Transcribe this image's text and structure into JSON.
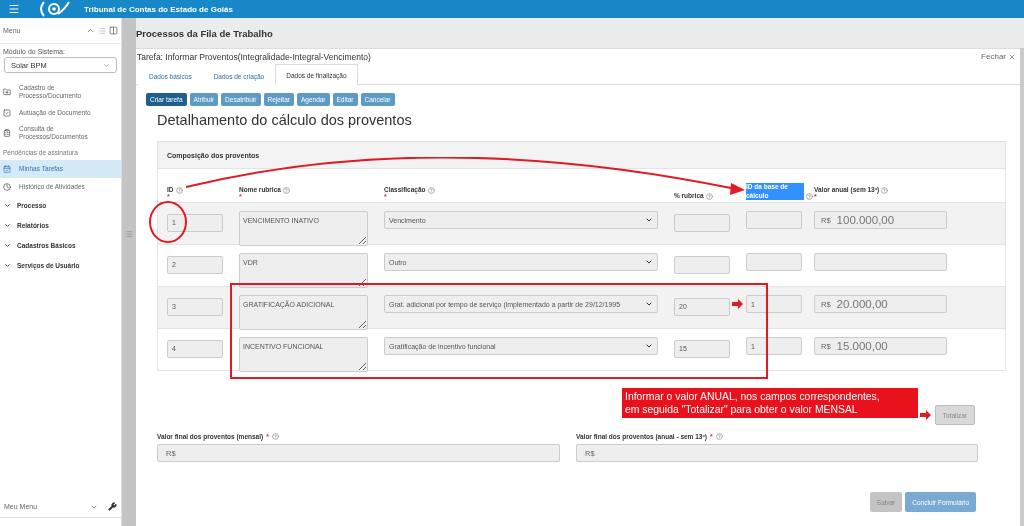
{
  "topbar": {
    "title": "Tribunal de Contas do Estado de Goiás"
  },
  "sidebar": {
    "menu_label": "Menu",
    "module_label": "Módulo do Sistema:",
    "module_value": "Solar BPM",
    "links": [
      {
        "kind": "link",
        "label": "Cadastro de Processo/Documento",
        "selected": false
      },
      {
        "kind": "link",
        "label": "Autuação de Documento",
        "selected": false
      },
      {
        "kind": "link",
        "label": "Consulta de Processos/Documentos",
        "selected": false
      },
      {
        "kind": "caption",
        "label": "Pendências de assinatura"
      },
      {
        "kind": "link",
        "label": "Minhas Tarefas",
        "selected": true
      },
      {
        "kind": "link",
        "label": "Histórico de Atividades",
        "selected": false
      },
      {
        "kind": "group",
        "label": "Processo"
      },
      {
        "kind": "group",
        "label": "Relatórios"
      },
      {
        "kind": "group",
        "label": "Cadastros Básicos"
      },
      {
        "kind": "group",
        "label": "Serviços de Usuário"
      }
    ],
    "footer": "Meu Menu"
  },
  "page_title": "Processos da Fila de Trabalho",
  "dialog": {
    "title": "Tarefa: Informar Proventos(Integralidade-Integral-Vencimento)",
    "close": "Fechar",
    "tabs": [
      {
        "label": "Dados básicos",
        "selected": false
      },
      {
        "label": "Dados de criação",
        "selected": false
      },
      {
        "label": "Dados de finalização",
        "selected": true
      }
    ],
    "actions": [
      {
        "label": "Criar tarefa",
        "primary": true
      },
      {
        "label": "Atribuir",
        "primary": false
      },
      {
        "label": "Desatribuir",
        "primary": false
      },
      {
        "label": "Rejeitar",
        "primary": false
      },
      {
        "label": "Agendar",
        "primary": false
      },
      {
        "label": "Editar",
        "primary": false
      },
      {
        "label": "Cancelar",
        "primary": false
      }
    ],
    "heading": "Detalhamento do cálculo dos proventos",
    "section_title": "Composição dos proventos",
    "columns": [
      {
        "label": "ID",
        "required_mark": "*",
        "highlighted": false
      },
      {
        "label": "Nome rubrica",
        "required_mark": "*",
        "highlighted": false
      },
      {
        "label": "Classificação",
        "required_mark": "*",
        "highlighted": false
      },
      {
        "label": "% rubrica",
        "highlighted": false
      },
      {
        "label": "ID da base de cálculo",
        "highlighted": true
      },
      {
        "label": "Valor anual (sem 13º)",
        "required_mark": "*",
        "highlighted": false
      }
    ],
    "rows": [
      {
        "id": "1",
        "name": "VENCIMENTO INATIVO",
        "classification": "Vencimento",
        "annual_prefix": "R$",
        "annual": "100.000,00"
      },
      {
        "id": "2",
        "name": "VDR",
        "classification": "Outro"
      },
      {
        "id": "3",
        "name": "GRATIFICAÇÃO ADICIONAL",
        "classification": "Grat. adicional por tempo de serviço (implementado a partir de 29/12/1995",
        "percent": "20",
        "base_id": "1",
        "annual_prefix": "R$",
        "annual": "20.000,00"
      },
      {
        "id": "4",
        "name": "INCENTIVO FUNCIONAL",
        "classification": "Gratificação de incentivo funcional",
        "percent": "15",
        "base_id": "1",
        "annual_prefix": "R$",
        "annual": "15.000,00"
      }
    ],
    "callout_lines": [
      "Informar o valor ANUAL, nos campos correspondentes,",
      "em seguida \"Totalizar\" para obter o valor MENSAL"
    ],
    "totalize": {
      "label": "Totalizar",
      "disabled": true
    },
    "totals": [
      {
        "label": "Valor final dos proventos (mensal)",
        "required_mark": "*",
        "prefix": "R$"
      },
      {
        "label": "Valor final dos proventos (anual - sem 13º)",
        "required_mark": "*",
        "prefix": "R$"
      }
    ],
    "buttons": [
      {
        "label": "Salvar",
        "disabled": true
      },
      {
        "label": "Concluir Formulário",
        "disabled": false
      }
    ]
  }
}
